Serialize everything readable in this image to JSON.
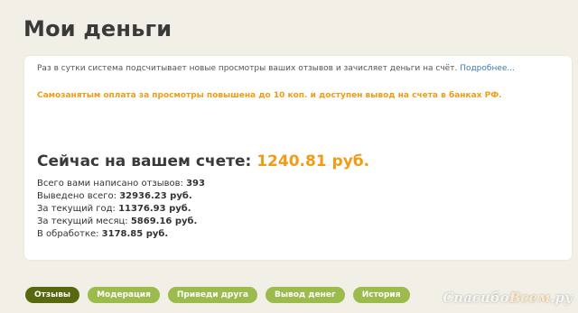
{
  "page": {
    "title": "Мои деньги"
  },
  "card": {
    "info_text": "Раз в сутки система подсчитывает новые просмотры ваших отзывов и зачисляет деньги на счёт.",
    "info_link": "Подробнее...",
    "promo_text": "Самозанятым оплата за просмотры повышена до 10 коп. и доступен вывод на счета в банках РФ.",
    "balance_label": "Сейчас на вашем счете:",
    "balance_amount": "1240.81 руб.",
    "stats": [
      {
        "label": "Всего вами написано отзывов:",
        "value": "393"
      },
      {
        "label": "Выведено всего:",
        "value": "32936.23 руб."
      },
      {
        "label": "За текущий год:",
        "value": "11376.93 руб."
      },
      {
        "label": "За текущий месяц:",
        "value": "5869.16 руб."
      },
      {
        "label": "В обработке:",
        "value": "3178.85 руб."
      }
    ]
  },
  "tabs": [
    {
      "label": "Отзывы",
      "active": true
    },
    {
      "label": "Модерация",
      "active": false
    },
    {
      "label": "Приведи друга",
      "active": false
    },
    {
      "label": "Вывод денег",
      "active": false
    },
    {
      "label": "История",
      "active": false
    }
  ],
  "watermark": {
    "part1": "Спасибо",
    "part2": "Всем",
    "part3": ".ру"
  },
  "colors": {
    "accent_orange": "#f39b14",
    "link_blue": "#3d7ab5",
    "tab_green": "#9bbc4c",
    "tab_active": "#56690f",
    "background": "#f2f0e6"
  }
}
